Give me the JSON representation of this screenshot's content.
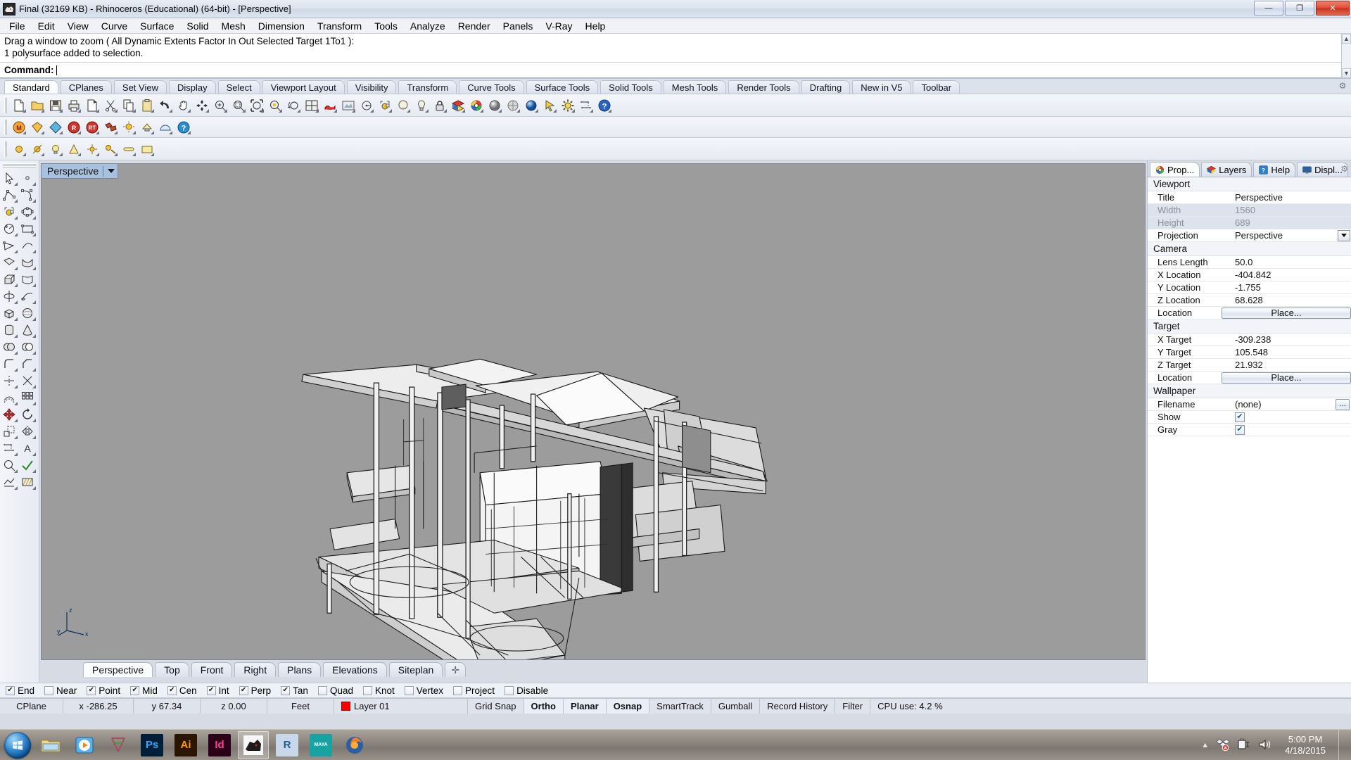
{
  "window": {
    "title": "Final (32169 KB) - Rhinoceros (Educational) (64-bit) - [Perspective]",
    "app_icon": "rhino-icon",
    "minimize_label": "—",
    "maximize_label": "❐",
    "close_label": "✕"
  },
  "menubar": {
    "items": [
      {
        "label": "File"
      },
      {
        "label": "Edit"
      },
      {
        "label": "View"
      },
      {
        "label": "Curve"
      },
      {
        "label": "Surface"
      },
      {
        "label": "Solid"
      },
      {
        "label": "Mesh"
      },
      {
        "label": "Dimension"
      },
      {
        "label": "Transform"
      },
      {
        "label": "Tools"
      },
      {
        "label": "Analyze"
      },
      {
        "label": "Render"
      },
      {
        "label": "Panels"
      },
      {
        "label": "V-Ray"
      },
      {
        "label": "Help"
      }
    ]
  },
  "command": {
    "history_line1": "Drag a window to zoom ( All  Dynamic  Extents  Factor  In  Out  Selected  Target  1To1 ):",
    "history_line2": "1 polysurface added to selection.",
    "prompt_label": "Command:",
    "input_value": "",
    "scroll_up": "▲",
    "scroll_down": "▼"
  },
  "toolbar_tabs": {
    "active": "Standard",
    "items": [
      {
        "label": "Standard"
      },
      {
        "label": "CPlanes"
      },
      {
        "label": "Set View"
      },
      {
        "label": "Display"
      },
      {
        "label": "Select"
      },
      {
        "label": "Viewport Layout"
      },
      {
        "label": "Visibility"
      },
      {
        "label": "Transform"
      },
      {
        "label": "Curve Tools"
      },
      {
        "label": "Surface Tools"
      },
      {
        "label": "Solid Tools"
      },
      {
        "label": "Mesh Tools"
      },
      {
        "label": "Render Tools"
      },
      {
        "label": "Drafting"
      },
      {
        "label": "New in V5"
      },
      {
        "label": "Toolbar"
      }
    ],
    "options_icon": "gear-icon"
  },
  "standard_toolbar": {
    "icons": [
      "new-file-icon",
      "open-folder-icon",
      "save-icon",
      "print-icon",
      "copy-to-clipboard-icon",
      "cut-icon",
      "copy-icon",
      "paste-icon",
      "undo-icon",
      "pan-icon",
      "rotate-view-icon",
      "zoom-in-icon",
      "zoom-window-icon",
      "zoom-extents-icon",
      "zoom-selected-icon",
      "zoom-previous-icon",
      "viewport-layout-icon",
      "render-icon",
      "render-preview-icon",
      "set-cplane-icon",
      "circle-icon",
      "object-properties-icon",
      "light-icon",
      "lock-icon",
      "layers-icon",
      "color-wheel-icon",
      "shaded-sphere-icon",
      "ghosted-sphere-icon",
      "rendered-sphere-icon",
      "select-icon",
      "options-gear-icon",
      "dimension-icon",
      "help-icon"
    ]
  },
  "vray_toolbar": {
    "icons": [
      "vray-material-icon",
      "vray-render-icon",
      "vray-frame-buffer-icon",
      "vray-render-last-icon",
      "vray-rt-icon",
      "vray-options-icon",
      "vray-sun-icon",
      "vray-light-icon",
      "vray-dome-icon",
      "vray-help-icon"
    ]
  },
  "sun_toolbar": {
    "icons": [
      "sun-icon",
      "sunlight-icon",
      "light-bulb-icon",
      "spotlight-icon",
      "point-light-icon",
      "directional-light-icon",
      "linear-light-icon",
      "rectangular-light-icon"
    ]
  },
  "left_toolbar": {
    "icons": [
      "select-arrow-icon",
      "point-icon",
      "polyline-icon",
      "curve-icon",
      "circle-icon",
      "ellipse-icon",
      "arc-icon",
      "rectangle-icon",
      "polygon-icon",
      "curve-from-obj-icon",
      "surface-corner-icon",
      "surface-edge-icon",
      "extrude-icon",
      "loft-icon",
      "revolve-icon",
      "sweep-icon",
      "box-icon",
      "sphere-icon",
      "cylinder-icon",
      "cone-icon",
      "boolean-union-icon",
      "boolean-diff-icon",
      "fillet-icon",
      "chamfer-icon",
      "trim-icon",
      "split-icon",
      "offset-icon",
      "array-icon",
      "move-icon",
      "rotate-icon",
      "scale-icon",
      "mirror-icon",
      "dimension-icon",
      "text-icon",
      "analyze-icon",
      "check-icon",
      "render-mesh-icon",
      "hatch-icon"
    ]
  },
  "viewport": {
    "label": "Perspective",
    "dropdown_icon": "chevron-down-icon",
    "background_color": "#9c9c9c",
    "axis": {
      "z": "z",
      "y": "y",
      "x": "x"
    }
  },
  "viewport_tabs": {
    "active": "Perspective",
    "items": [
      {
        "label": "Perspective"
      },
      {
        "label": "Top"
      },
      {
        "label": "Front"
      },
      {
        "label": "Right"
      },
      {
        "label": "Plans"
      },
      {
        "label": "Elevations"
      },
      {
        "label": "Siteplan"
      }
    ],
    "add_label": "✛"
  },
  "panel": {
    "tabs": [
      {
        "label": "Prop...",
        "icon": "properties-icon",
        "active": true
      },
      {
        "label": "Layers",
        "icon": "layers-icon",
        "active": false
      },
      {
        "label": "Help",
        "icon": "help-icon",
        "active": false
      },
      {
        "label": "Displ...",
        "icon": "display-icon",
        "active": false
      }
    ],
    "options_icon": "gear-icon",
    "groups": [
      {
        "title": "Viewport",
        "rows": [
          {
            "key": "Title",
            "value": "Perspective",
            "type": "text"
          },
          {
            "key": "Width",
            "value": "1560",
            "type": "text",
            "disabled": true
          },
          {
            "key": "Height",
            "value": "689",
            "type": "text",
            "disabled": true
          },
          {
            "key": "Projection",
            "value": "Perspective",
            "type": "select"
          }
        ]
      },
      {
        "title": "Camera",
        "rows": [
          {
            "key": "Lens Length",
            "value": "50.0",
            "type": "text"
          },
          {
            "key": "X Location",
            "value": "-404.842",
            "type": "text"
          },
          {
            "key": "Y Location",
            "value": "-1.755",
            "type": "text"
          },
          {
            "key": "Z Location",
            "value": "68.628",
            "type": "text"
          },
          {
            "key": "Location",
            "value": "Place...",
            "type": "button"
          }
        ]
      },
      {
        "title": "Target",
        "rows": [
          {
            "key": "X Target",
            "value": "-309.238",
            "type": "text"
          },
          {
            "key": "Y Target",
            "value": "105.548",
            "type": "text"
          },
          {
            "key": "Z Target",
            "value": "21.932",
            "type": "text"
          },
          {
            "key": "Location",
            "value": "Place...",
            "type": "button"
          }
        ]
      },
      {
        "title": "Wallpaper",
        "rows": [
          {
            "key": "Filename",
            "value": "(none)",
            "type": "file"
          },
          {
            "key": "Show",
            "value": "✔",
            "type": "checkbox",
            "checked": true
          },
          {
            "key": "Gray",
            "value": "✔",
            "type": "checkbox",
            "checked": true
          }
        ]
      }
    ]
  },
  "osnap": {
    "items": [
      {
        "label": "End",
        "checked": true
      },
      {
        "label": "Near",
        "checked": false
      },
      {
        "label": "Point",
        "checked": true
      },
      {
        "label": "Mid",
        "checked": true
      },
      {
        "label": "Cen",
        "checked": true
      },
      {
        "label": "Int",
        "checked": true
      },
      {
        "label": "Perp",
        "checked": true
      },
      {
        "label": "Tan",
        "checked": true
      },
      {
        "label": "Quad",
        "checked": false
      },
      {
        "label": "Knot",
        "checked": false
      },
      {
        "label": "Vertex",
        "checked": false
      },
      {
        "label": "Project",
        "checked": false
      },
      {
        "label": "Disable",
        "checked": false
      }
    ],
    "check_glyph": "✔"
  },
  "statusbar": {
    "cplane_label": "CPlane",
    "x": "x -286.25",
    "y": "y 67.34",
    "z": "z 0.00",
    "units": "Feet",
    "layer_label": "Layer 01",
    "layer_color": "#ff0000",
    "toggles": [
      {
        "label": "Grid Snap",
        "active": false
      },
      {
        "label": "Ortho",
        "active": true
      },
      {
        "label": "Planar",
        "active": true
      },
      {
        "label": "Osnap",
        "active": true
      },
      {
        "label": "SmartTrack",
        "active": false
      },
      {
        "label": "Gumball",
        "active": false
      },
      {
        "label": "Record History",
        "active": false
      },
      {
        "label": "Filter",
        "active": false
      }
    ],
    "cpu": "CPU use: 4.2 %"
  },
  "taskbar": {
    "start_icon": "windows-start-orb-icon",
    "items": [
      {
        "name": "explorer-icon",
        "label": "",
        "color": "#f2d98a"
      },
      {
        "name": "media-player-icon",
        "label": "",
        "color": "#3aa0e0"
      },
      {
        "name": "3ds-max-icon",
        "label": "",
        "color": "#4aa3d8"
      },
      {
        "name": "photoshop-icon",
        "label": "Ps",
        "color": "#001e36",
        "text_color": "#31a8ff"
      },
      {
        "name": "illustrator-icon",
        "label": "Ai",
        "color": "#2a1600",
        "text_color": "#ff9a00"
      },
      {
        "name": "indesign-icon",
        "label": "Id",
        "color": "#2b0019",
        "text_color": "#ff3f91"
      },
      {
        "name": "rhino-icon",
        "label": "",
        "color": "#f5f5f5",
        "active": true
      },
      {
        "name": "revit-icon",
        "label": "R",
        "color": "#c9d8e8",
        "text_color": "#1d5c9e"
      },
      {
        "name": "maya-icon",
        "label": "MAYA",
        "color": "#17a3a3",
        "text_color": "#ffffff"
      },
      {
        "name": "firefox-icon",
        "label": "",
        "color": "#ff7139"
      }
    ],
    "tray": {
      "show_hidden_icon": "chevron-up-icon",
      "dropbox_icon": "dropbox-error-icon",
      "battery_icon": "battery-charging-icon",
      "volume_icon": "speaker-icon",
      "time": "5:00 PM",
      "date": "4/18/2015"
    }
  }
}
